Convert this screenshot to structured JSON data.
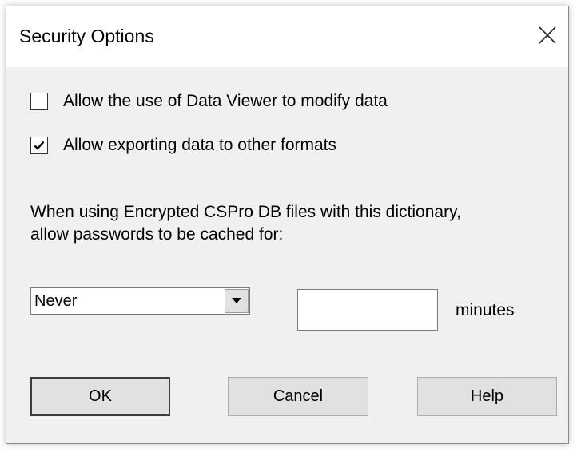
{
  "dialog": {
    "title": "Security Options"
  },
  "options": {
    "allow_modify": {
      "label": "Allow the use of Data Viewer to modify data",
      "checked": false
    },
    "allow_export": {
      "label": "Allow exporting data to other formats",
      "checked": true
    }
  },
  "cache": {
    "line1": "When using Encrypted CSPro DB files with this dictionary,",
    "line2": "allow passwords to be cached for:",
    "selected": "Never",
    "minutes_value": "",
    "minutes_label": "minutes"
  },
  "buttons": {
    "ok": "OK",
    "cancel": "Cancel",
    "help": "Help"
  },
  "icons": {
    "close": "close-icon",
    "checkmark": "checkmark-icon",
    "dropdown_arrow": "triangle-down-icon"
  },
  "colors": {
    "dialog_bg": "#f0f0f0",
    "titlebar_bg": "#ffffff",
    "button_bg": "#e1e1e1"
  }
}
